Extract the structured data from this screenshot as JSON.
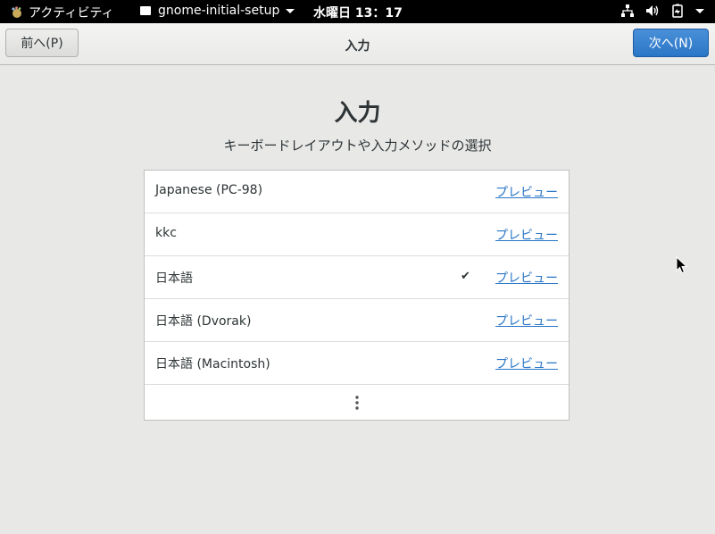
{
  "topbar": {
    "activities_label": "アクティビティ",
    "app_menu_label": "gnome-initial-setup",
    "clock": "水曜日 13：17",
    "icons": [
      "network-icon",
      "volume-icon",
      "battery-icon",
      "chevron-down-icon"
    ]
  },
  "header": {
    "prev_label": "前へ(P)",
    "title": "入力",
    "next_label": "次へ(N)",
    "next_color": "#2a76c6"
  },
  "main": {
    "title": "入力",
    "subtitle": "キーボードレイアウトや入力メソッドの選択"
  },
  "layouts": {
    "preview_label": "プレビュー",
    "items": [
      {
        "name": "Japanese (PC-98)",
        "selected": false
      },
      {
        "name": "kkc",
        "selected": false
      },
      {
        "name": "日本語",
        "selected": true
      },
      {
        "name": "日本語 (Dvorak)",
        "selected": false
      },
      {
        "name": "日本語 (Macintosh)",
        "selected": false
      }
    ],
    "more_icon": "more-vertical-icon"
  },
  "colors": {
    "link": "#2a76c6",
    "background": "#e8e8e7"
  }
}
